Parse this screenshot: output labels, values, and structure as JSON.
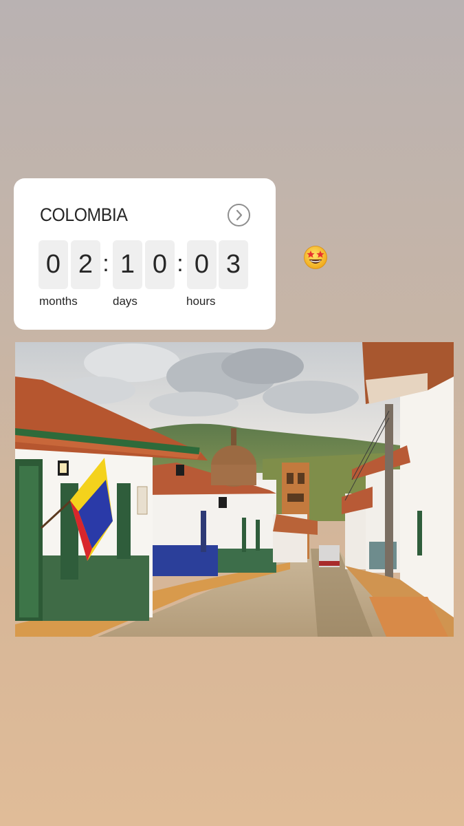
{
  "countdown": {
    "title": "COLOMBIA",
    "digits": [
      "0",
      "2",
      "1",
      "0",
      "0",
      "3"
    ],
    "separator": ":",
    "units": {
      "months": "months",
      "days": "days",
      "hours": "hours"
    }
  },
  "sticker": {
    "icon": "star-struck-emoji-icon"
  },
  "photo": {
    "subject": "colonial-street-with-colombian-flag"
  },
  "colors": {
    "card_background": "#ffffff",
    "digit_tile": "#efefef",
    "text": "#262626",
    "flag_yellow": "#f4d21c",
    "flag_blue": "#2a3aa8",
    "flag_red": "#d8262c"
  }
}
